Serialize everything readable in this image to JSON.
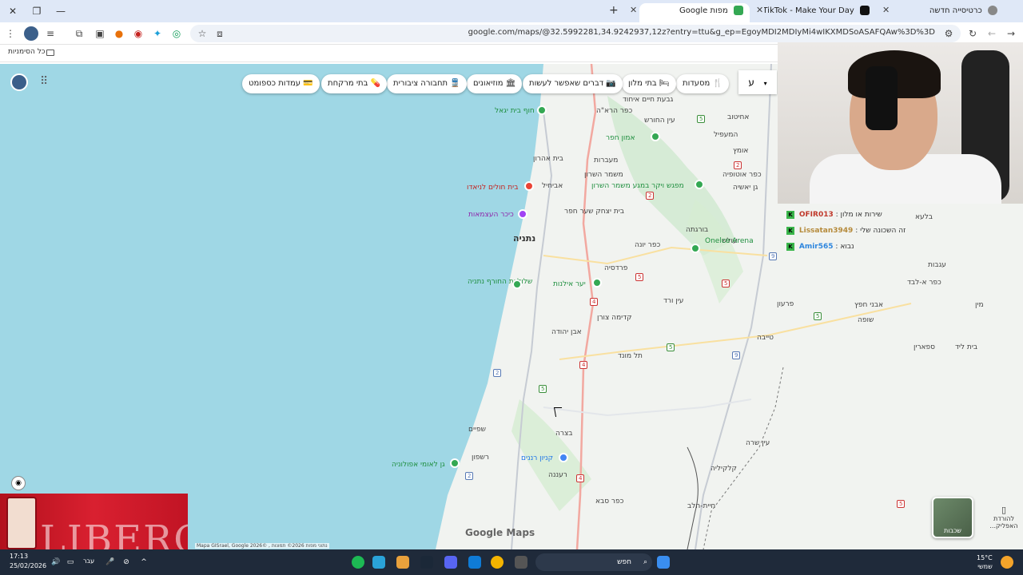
{
  "browser": {
    "tabs": [
      {
        "label": "כרטיסייה חדשה",
        "active": false
      },
      {
        "label": "TikTok - Make Your Day",
        "active": false
      },
      {
        "label": "מפות Google",
        "active": true
      }
    ],
    "url": "google.com/maps/@32.5992281,34.9242937,12z?entry=ttu&g_ep=EgoyMDI2MDIyMi4wIKXMDSoASAFQAw%3D%3D",
    "bookmarks_all": "כל הסימניות"
  },
  "map": {
    "search_placeholder": "ע",
    "chips": [
      {
        "label": "מסעדות",
        "icon": "🍴"
      },
      {
        "label": "בתי מלון",
        "icon": "🛏"
      },
      {
        "label": "דברים שאפשר לעשות",
        "icon": "📷"
      },
      {
        "label": "מוזיאונים",
        "icon": "🏛"
      },
      {
        "label": "תחבורה ציבורית",
        "icon": "🚆"
      },
      {
        "label": "בתי מרקחת",
        "icon": "💊"
      },
      {
        "label": "עמדות כספומט",
        "icon": "💳"
      }
    ],
    "places": [
      {
        "name": "גבעת חיים איחוד"
      },
      {
        "name": "כפר הרא\"ה"
      },
      {
        "name": "עין החורש"
      },
      {
        "name": "אחיטוב"
      },
      {
        "name": "המעפיל"
      },
      {
        "name": "חוף בית יגאל"
      },
      {
        "name": "אמון חפר"
      },
      {
        "name": "אומץ"
      },
      {
        "name": "בית אהרון"
      },
      {
        "name": "מעברות"
      },
      {
        "name": "משמר השרון"
      },
      {
        "name": "כפר אוטופיה"
      },
      {
        "name": "בית חולים לניאדו"
      },
      {
        "name": "אביחיל"
      },
      {
        "name": "מפגש ויקר במגע משמר השרון"
      },
      {
        "name": "גן יאשיה"
      },
      {
        "name": "כיכר העצמאות"
      },
      {
        "name": "בית יצחק שער חפר"
      },
      {
        "name": "נתניה"
      },
      {
        "name": "עולש"
      },
      {
        "name": "בורגתה"
      },
      {
        "name": "Onelce Arena"
      },
      {
        "name": "כפר יונה"
      },
      {
        "name": "שלוליות החורף נתניה"
      },
      {
        "name": "יער אילנות"
      },
      {
        "name": "פרדסיה"
      },
      {
        "name": "עין ורד"
      },
      {
        "name": "אבן יהודה"
      },
      {
        "name": "קדימה צורן"
      },
      {
        "name": "תל מונד"
      },
      {
        "name": "טייבה"
      },
      {
        "name": "פרעון"
      },
      {
        "name": "בלעא"
      },
      {
        "name": "עגבות"
      },
      {
        "name": "כפר א-לבד"
      },
      {
        "name": "אבני חפץ"
      },
      {
        "name": "שופה"
      },
      {
        "name": "בית ליד"
      },
      {
        "name": "ספארין"
      },
      {
        "name": "שפיים"
      },
      {
        "name": "בצרה"
      },
      {
        "name": "קניון רננים"
      },
      {
        "name": "רשפון"
      },
      {
        "name": "גן לאומי אפולוניה"
      },
      {
        "name": "רעננה"
      },
      {
        "name": "קלקיליה"
      },
      {
        "name": "כפר סבא"
      },
      {
        "name": "חיית-חלב"
      },
      {
        "name": "עין שרה"
      },
      {
        "name": "מין"
      }
    ],
    "layers_label": "שכבות",
    "download_app": "להורדת האפליק...",
    "logo": "Google Maps",
    "credits": "Mapa GISrael, Google 2026© , נתוני מפות 2026© תמונות"
  },
  "chat": [
    {
      "user": "OFIR013",
      "text": ": שירות או מלון",
      "color": "#c0392b"
    },
    {
      "user": "Lissatan3949",
      "text": ": זה השכונה שלי",
      "color": "#b58a3a"
    },
    {
      "user": "Amir565",
      "text": ": נבוא",
      "color": "#2e86de"
    }
  ],
  "ad": {
    "word": "LIBERO"
  },
  "taskbar": {
    "time": "17:13",
    "date": "25/02/2026",
    "lang": "עבר",
    "search": "חפש",
    "temp": "15°C",
    "weather": "שמשי"
  }
}
